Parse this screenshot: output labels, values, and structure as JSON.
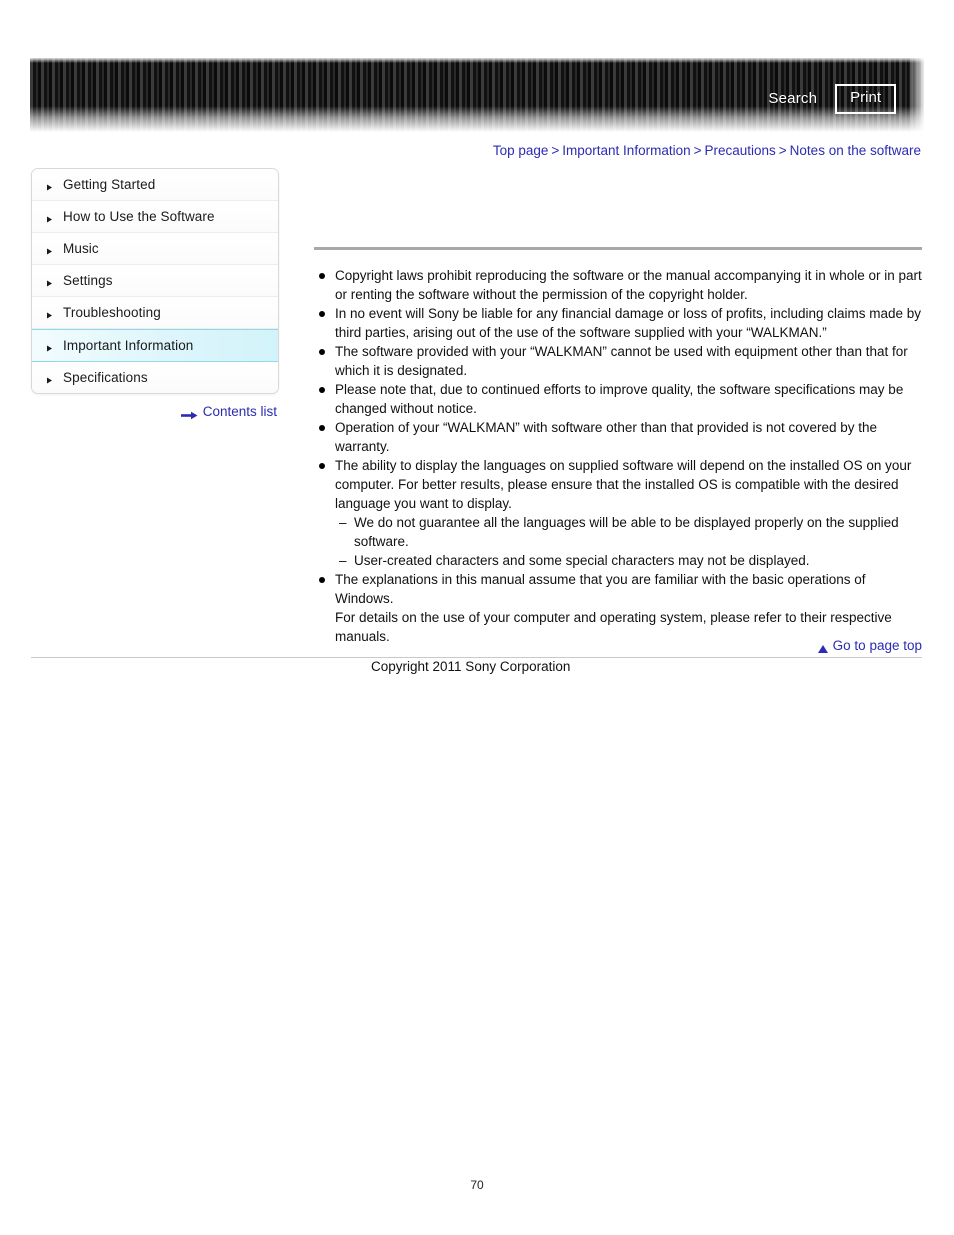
{
  "header": {
    "search_label": "Search",
    "print_label": "Print"
  },
  "breadcrumb": {
    "separator": ">",
    "items": [
      {
        "label": "Top page"
      },
      {
        "label": "Important Information"
      },
      {
        "label": "Precautions"
      },
      {
        "label": "Notes on the software"
      }
    ]
  },
  "sidebar": {
    "items": [
      {
        "label": "Getting Started",
        "active": false
      },
      {
        "label": "How to Use the Software",
        "active": false
      },
      {
        "label": "Music",
        "active": false
      },
      {
        "label": "Settings",
        "active": false
      },
      {
        "label": "Troubleshooting",
        "active": false
      },
      {
        "label": "Important Information",
        "active": true
      },
      {
        "label": "Specifications",
        "active": false
      }
    ],
    "contents_list_label": "Contents list",
    "active_highlight_color": "#d2f3fa",
    "link_color": "#2b2bb4"
  },
  "main": {
    "title": "",
    "bullets": [
      {
        "paragraphs": [
          "Copyright laws prohibit reproducing the software or the manual accompanying it in whole or in part or renting the software without the permission of the copyright holder."
        ],
        "subs": []
      },
      {
        "paragraphs": [
          "In no event will Sony be liable for any financial damage or loss of profits, including claims made by third parties, arising out of the use of the software supplied with your “WALKMAN.”"
        ],
        "subs": []
      },
      {
        "paragraphs": [
          "The software provided with your “WALKMAN” cannot be used with equipment other than that for which it is designated."
        ],
        "subs": []
      },
      {
        "paragraphs": [
          "Please note that, due to continued efforts to improve quality, the software specifications may be changed without notice."
        ],
        "subs": []
      },
      {
        "paragraphs": [
          "Operation of your “WALKMAN” with software other than that provided is not covered by the warranty."
        ],
        "subs": []
      },
      {
        "paragraphs": [
          "The ability to display the languages on supplied software will depend on the installed OS on your computer. For better results, please ensure that the installed OS is compatible with the desired language you want to display."
        ],
        "subs": [
          "We do not guarantee all the languages will be able to be displayed properly on the supplied software.",
          "User-created characters and some special characters may not be displayed."
        ]
      },
      {
        "paragraphs": [
          "The explanations in this manual assume that you are familiar with the basic operations of Windows.",
          "For details on the use of your computer and operating system, please refer to their respective manuals."
        ],
        "subs": []
      }
    ]
  },
  "footer": {
    "go_to_page_top_label": "Go to page top",
    "copyright": "Copyright 2011 Sony Corporation",
    "page_number": "70"
  }
}
